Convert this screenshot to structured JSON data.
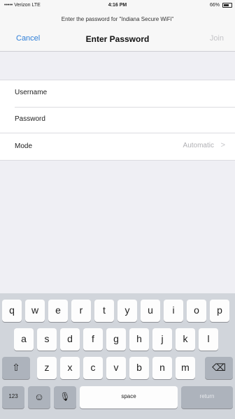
{
  "status_bar": {
    "carrier": "••••• Verizon LTE",
    "time": "4:16 PM",
    "battery": "66%",
    "battery_level": 0.66
  },
  "prompt": "Enter the password for \"Indiana Secure WiFi\"",
  "nav": {
    "cancel": "Cancel",
    "title": "Enter Password",
    "join": "Join"
  },
  "fields": {
    "username": "Username",
    "password": "Password"
  },
  "mode": {
    "label": "Mode",
    "value": "Automatic",
    "chevron": ">"
  },
  "keyboard": {
    "row1": [
      "q",
      "w",
      "e",
      "r",
      "t",
      "y",
      "u",
      "i",
      "o",
      "p"
    ],
    "row2": [
      "a",
      "s",
      "d",
      "f",
      "g",
      "h",
      "j",
      "k",
      "l"
    ],
    "row3": [
      "z",
      "x",
      "c",
      "v",
      "b",
      "n",
      "m"
    ],
    "shift": "⇧",
    "delete": "⌫",
    "numbers": "123",
    "emoji": "☺",
    "mic": "🎙",
    "space": "space",
    "return": "return"
  }
}
